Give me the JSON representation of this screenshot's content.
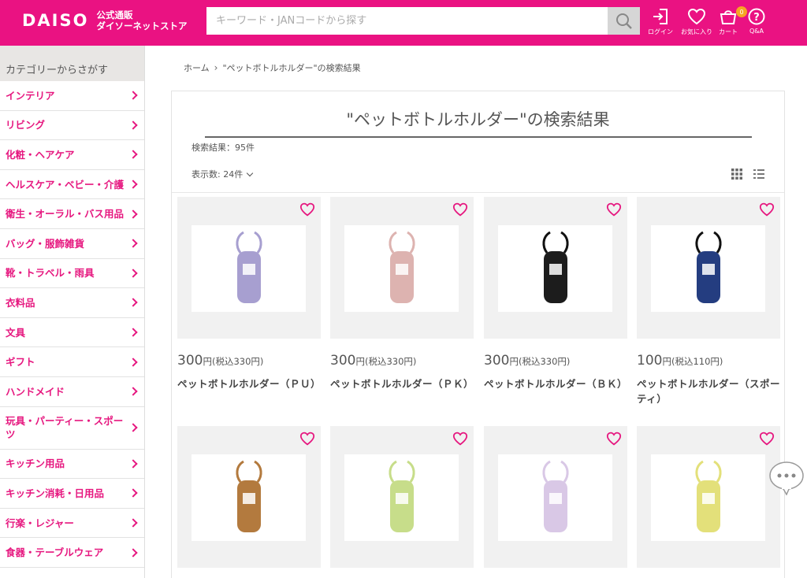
{
  "header": {
    "logo_word": "DAISO",
    "logo_sub1": "公式通販",
    "logo_sub2": "ダイソーネットストア",
    "search_placeholder": "キーワード・JANコードから探す",
    "icons": [
      {
        "name": "login",
        "label": "ログイン"
      },
      {
        "name": "favorites",
        "label": "お気に入り"
      },
      {
        "name": "cart",
        "label": "カート",
        "badge": "0"
      },
      {
        "name": "qa",
        "label": "Q&A"
      }
    ],
    "color": "#ea1282"
  },
  "sidebar": {
    "heading": "カテゴリーからさがす",
    "items": [
      {
        "label": "インテリア"
      },
      {
        "label": "リビング"
      },
      {
        "label": "化粧・ヘアケア"
      },
      {
        "label": "ヘルスケア・ベビー・介護"
      },
      {
        "label": "衛生・オーラル・バス用品"
      },
      {
        "label": "バッグ・服飾雑貨"
      },
      {
        "label": "靴・トラベル・雨具"
      },
      {
        "label": "衣料品"
      },
      {
        "label": "文具"
      },
      {
        "label": "ギフト"
      },
      {
        "label": "ハンドメイド"
      },
      {
        "label": "玩具・パーティー・スポーツ"
      },
      {
        "label": "キッチン用品"
      },
      {
        "label": "キッチン消耗・日用品"
      },
      {
        "label": "行楽・レジャー"
      },
      {
        "label": "食器・テーブルウェア"
      }
    ]
  },
  "breadcrumb": {
    "home": "ホーム",
    "current": "\"ペットボトルホルダー\"の検索結果"
  },
  "results": {
    "title": "\"ペットボトルホルダー\"の検索結果",
    "count": "検索結果：95件",
    "per_page": "表示数: 24件"
  },
  "products": [
    {
      "price": "300",
      "unit": "円",
      "tax": "(税込330円)",
      "name": "ペットボトルホルダー（ＰＵ）",
      "color": "#a79fd0"
    },
    {
      "price": "300",
      "unit": "円",
      "tax": "(税込330円)",
      "name": "ペットボトルホルダー（ＰＫ）",
      "color": "#ddb3b0"
    },
    {
      "price": "300",
      "unit": "円",
      "tax": "(税込330円)",
      "name": "ペットボトルホルダー（ＢＫ）",
      "color": "#1c1c1c"
    },
    {
      "price": "100",
      "unit": "円",
      "tax": "(税込110円)",
      "name": "ペットボトルホルダー（スポーティ）",
      "color": "#243d80"
    },
    {
      "name": "",
      "color": "#b37a3e"
    },
    {
      "name": "",
      "color": "#c7dd8a"
    },
    {
      "name": "",
      "color": "#d9c8e6"
    },
    {
      "name": "",
      "color": "#e3e07a"
    }
  ]
}
